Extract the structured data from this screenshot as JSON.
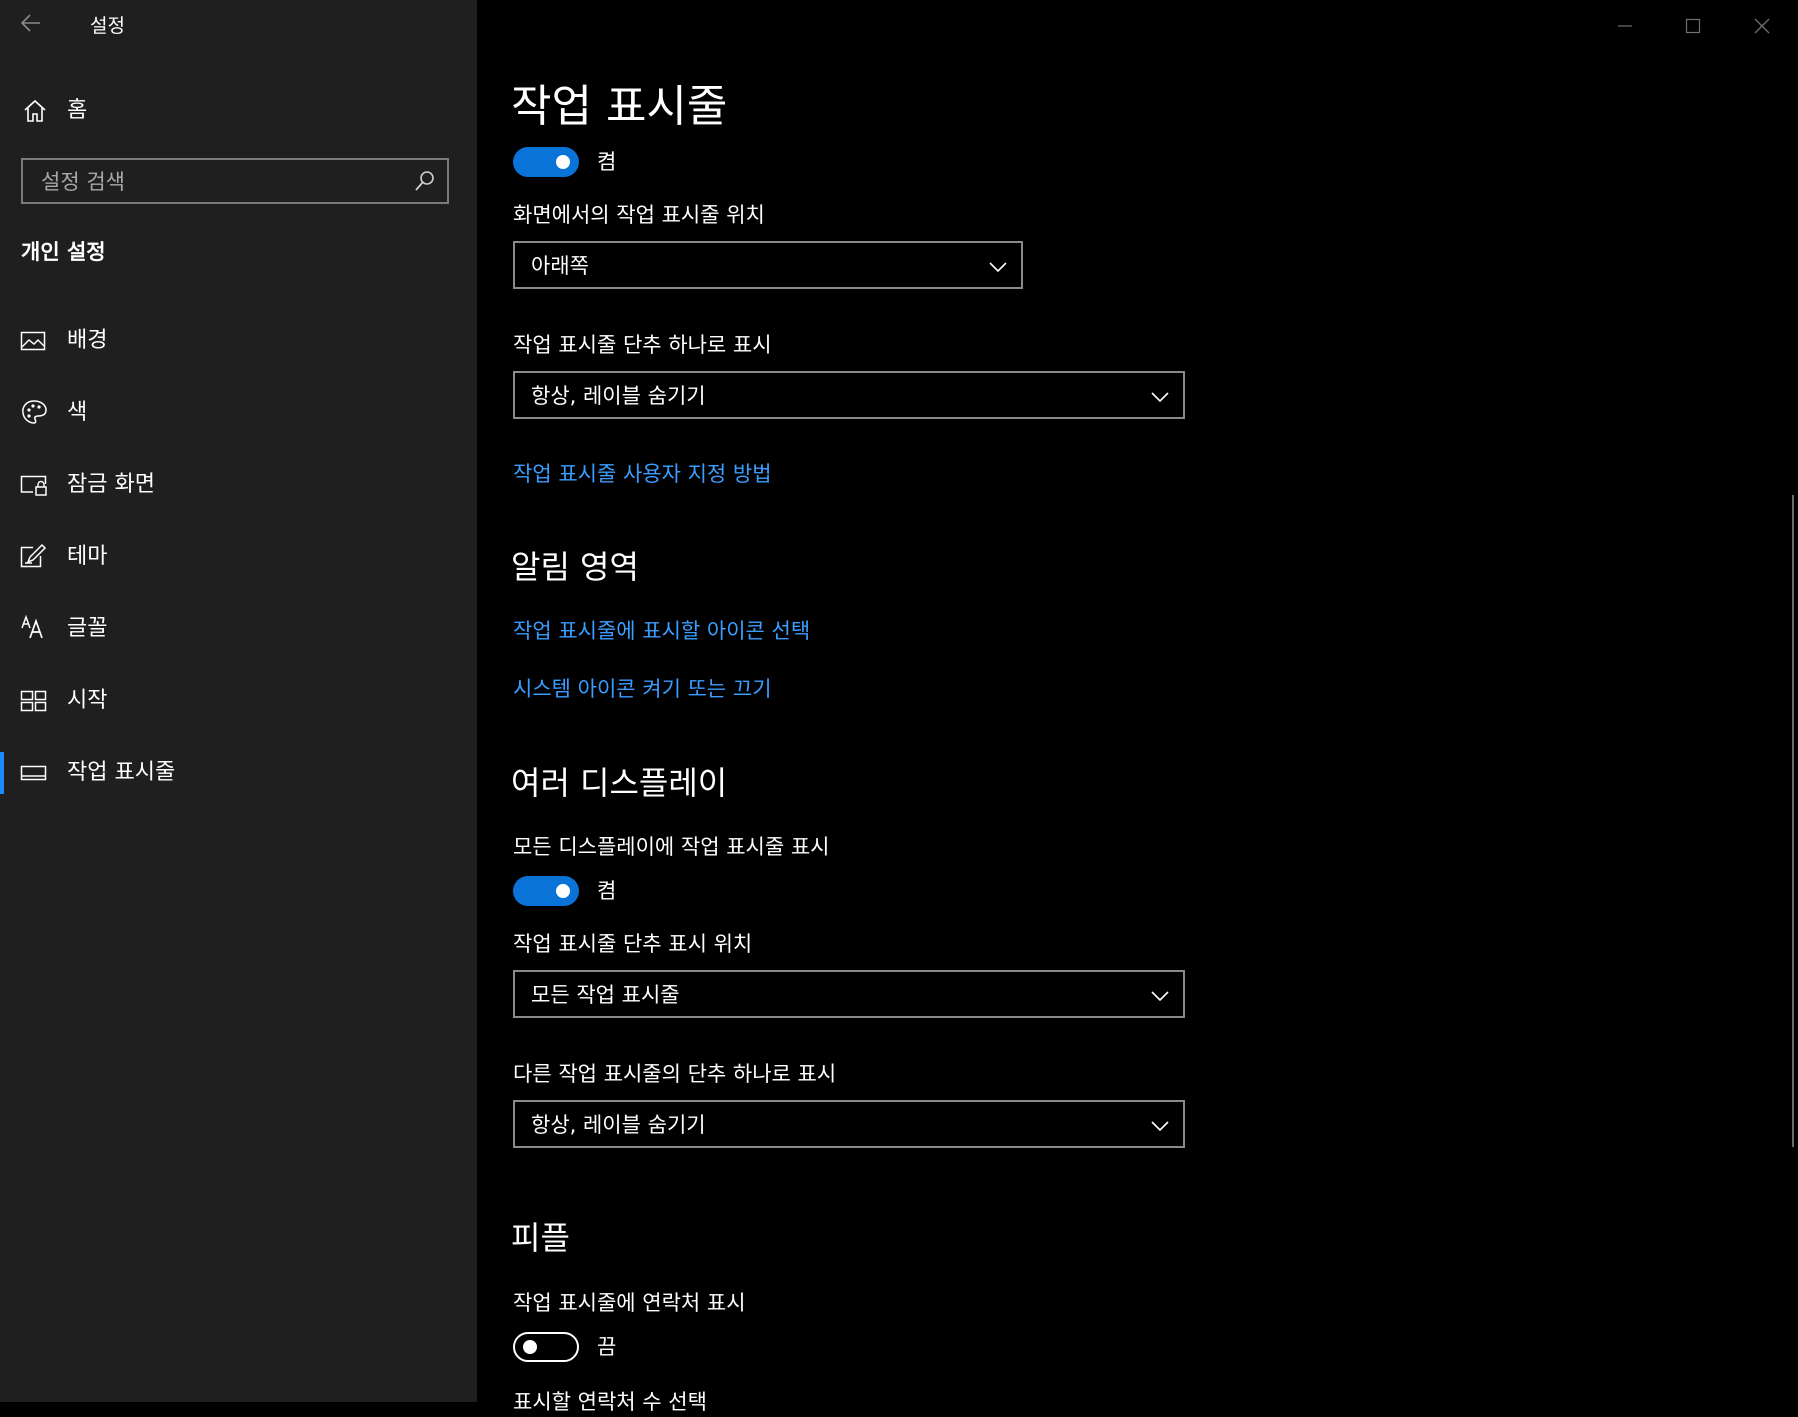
{
  "window": {
    "back_icon": "back-arrow-icon",
    "title": "설정",
    "controls": [
      "minimize-icon",
      "maximize-icon",
      "close-icon"
    ]
  },
  "sidebar": {
    "home_label": "홈",
    "search_placeholder": "설정 검색",
    "section_title": "개인 설정",
    "items": [
      {
        "label": "배경",
        "icon": "picture-icon",
        "active": false
      },
      {
        "label": "색",
        "icon": "palette-icon",
        "active": false
      },
      {
        "label": "잠금 화면",
        "icon": "lock-screen-icon",
        "active": false
      },
      {
        "label": "테마",
        "icon": "theme-brush-icon",
        "active": false
      },
      {
        "label": "글꼴",
        "icon": "font-icon",
        "active": false
      },
      {
        "label": "시작",
        "icon": "start-tiles-icon",
        "active": false
      },
      {
        "label": "작업 표시줄",
        "icon": "taskbar-icon",
        "active": true
      }
    ],
    "accent_color": "#1a8cff"
  },
  "main": {
    "page_title": "작업 표시줄",
    "top_toggle_state": "켬",
    "taskbar_position": {
      "label": "화면에서의 작업 표시줄 위치",
      "value": "아래쪽"
    },
    "combine_buttons": {
      "label": "작업 표시줄 단추 하나로 표시",
      "value": "항상, 레이블 숨기기"
    },
    "customize_link": "작업 표시줄 사용자 지정 방법",
    "notification_area": {
      "heading": "알림 영역",
      "links": [
        "작업 표시줄에 표시할 아이콘 선택",
        "시스템 아이콘 켜기 또는 끄기"
      ]
    },
    "multiple_displays": {
      "heading": "여러 디스플레이",
      "show_all_label": "모든 디스플레이에 작업 표시줄 표시",
      "show_all_state": "켬",
      "buttons_location_label": "작업 표시줄 단추 표시 위치",
      "buttons_location_value": "모든 작업 표시줄",
      "combine_other_label": "다른 작업 표시줄의 단추 하나로 표시",
      "combine_other_value": "항상, 레이블 숨기기"
    },
    "people": {
      "heading": "피플",
      "contacts_label": "작업 표시줄에 연락처 표시",
      "contacts_state": "끔",
      "contacts_count_label": "표시할 연락처 수 선택"
    },
    "toggle_on_color": "#0a73d8",
    "link_color": "#3a9dff"
  }
}
